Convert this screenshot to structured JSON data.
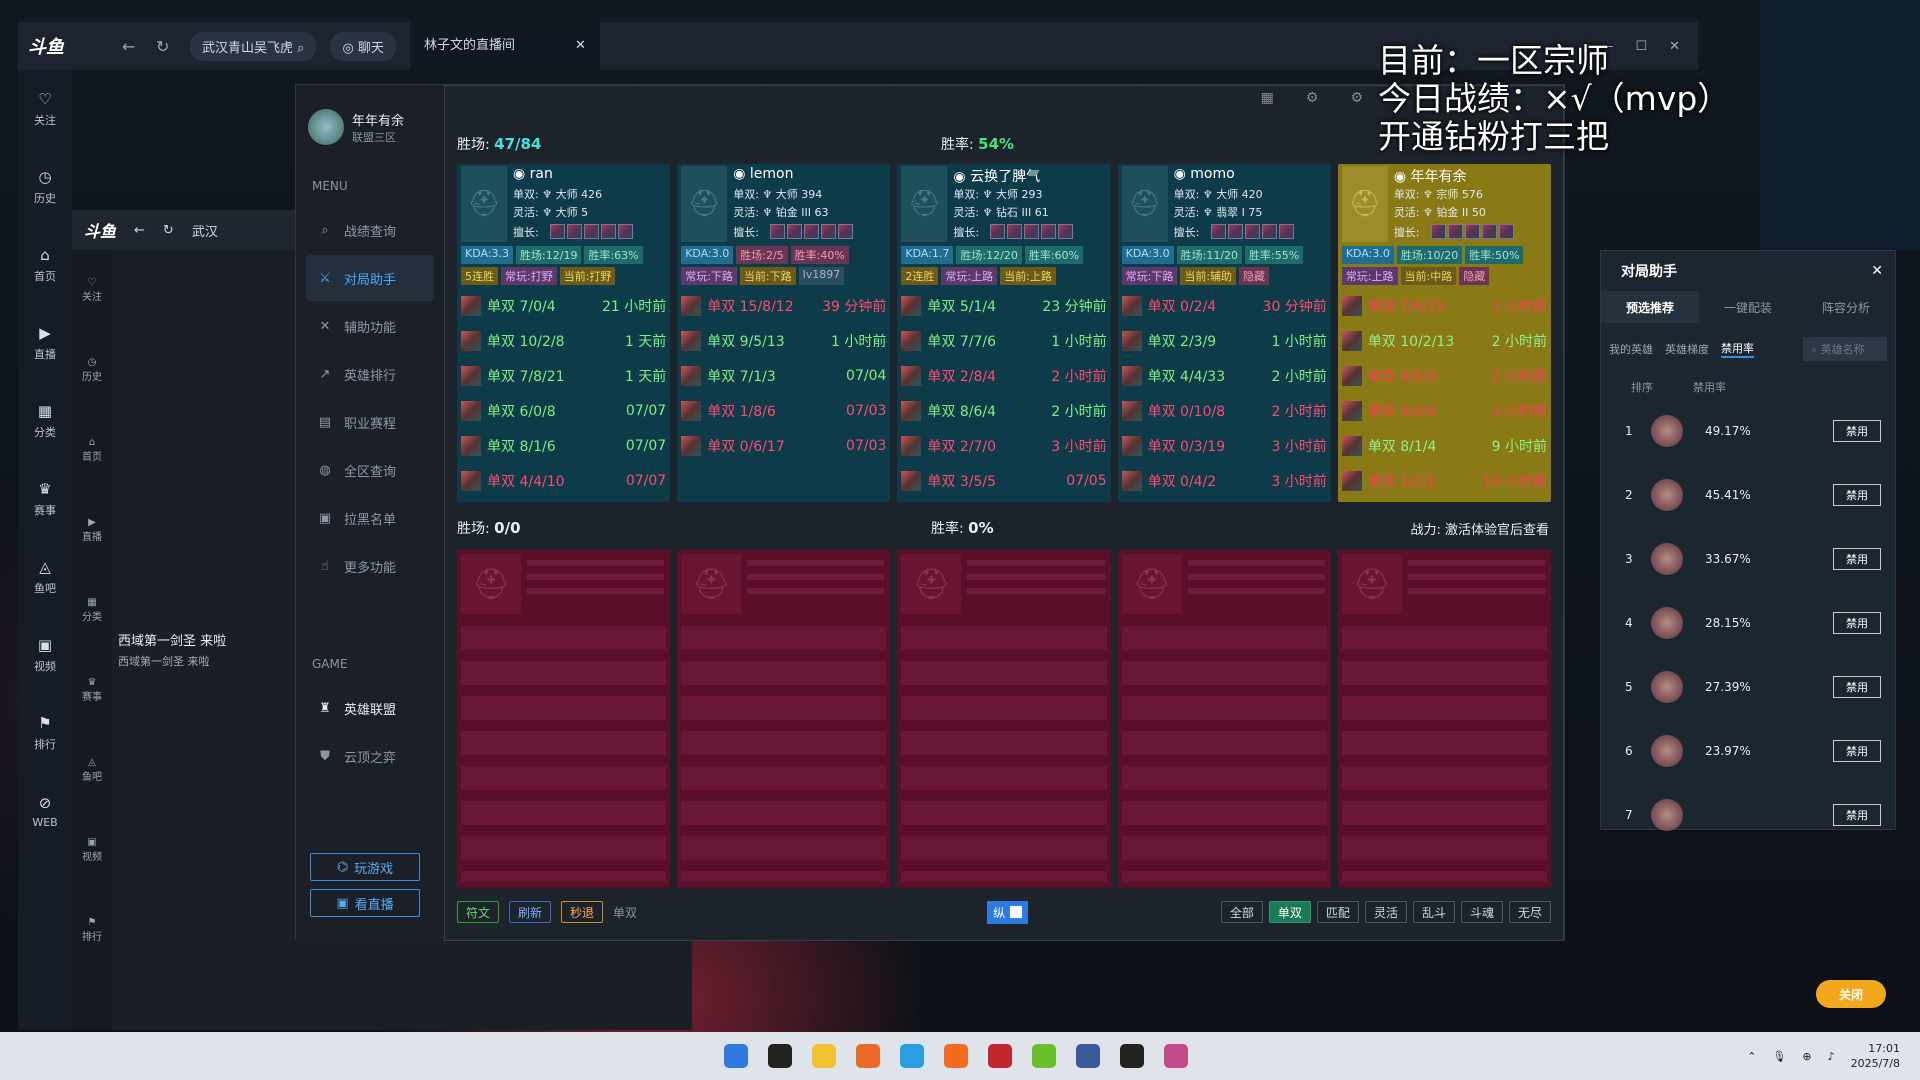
{
  "douyu": {
    "logo": "斗鱼",
    "location": "武汉青山吴飞虎",
    "chat": "聊天",
    "tab_title": "林子文的直播间"
  },
  "rail": [
    "关注",
    "历史",
    "首页",
    "直播",
    "分类",
    "赛事",
    "鱼吧",
    "视频",
    "排行",
    "WEB"
  ],
  "inner": {
    "location": "武汉",
    "rail": [
      "关注",
      "历史",
      "首页",
      "直播",
      "分类",
      "赛事",
      "鱼吧",
      "视频",
      "排行",
      "WEB"
    ],
    "msg1": "西域第一剑圣 来啦",
    "msg2": "西域第一剑圣 来啦"
  },
  "caption": {
    "line1": "目前：一区宗师",
    "line2": "今日战绩：×√（mvp）",
    "line3": "开通钻粉打三把"
  },
  "sidebar": {
    "name": "年年有余",
    "server": "联盟三区",
    "menu": "MENU",
    "items": [
      "战绩查询",
      "对局助手",
      "辅助功能",
      "英雄排行",
      "职业赛程",
      "全区查询",
      "拉黑名单",
      "更多功能"
    ],
    "game": "GAME",
    "games": [
      "英雄联盟",
      "云顶之弈"
    ],
    "play": "玩游戏",
    "watch": "看直播"
  },
  "ally": {
    "wins_label": "胜场:",
    "wins": "47/84",
    "rate_label": "胜率:",
    "rate": "54%"
  },
  "enemy": {
    "wins_label": "胜场:",
    "wins": "0/0",
    "rate_label": "胜率:",
    "rate": "0%",
    "power": "战力: 激活体验官后查看"
  },
  "players": [
    {
      "name": "ran",
      "solo": "单双: ",
      "solo_rank": "大师 426",
      "flex": "灵活: ",
      "flex_rank": "大师 5",
      "good": "擅长:",
      "tags": [
        [
          "KDA:3.3",
          "k"
        ],
        [
          "胜场:12/19",
          "t"
        ],
        [
          "胜率:63%",
          "t"
        ],
        [
          "5连胜",
          "y"
        ],
        [
          "常玩:打野",
          "p"
        ],
        [
          "当前:打野",
          "y"
        ]
      ],
      "matches": [
        [
          "单双 7/0/4",
          "21 小时前",
          "w"
        ],
        [
          "单双 10/2/8",
          "1 天前",
          "w"
        ],
        [
          "单双 7/8/21",
          "1 天前",
          "w"
        ],
        [
          "单双 6/0/8",
          "07/07",
          "w"
        ],
        [
          "单双 8/1/6",
          "07/07",
          "w"
        ],
        [
          "单双 4/4/10",
          "07/07",
          "l"
        ]
      ]
    },
    {
      "name": "lemon",
      "solo": "单双: ",
      "solo_rank": "大师 394",
      "flex": "灵活: ",
      "flex_rank": "铂金 III 63",
      "good": "擅长:",
      "tags": [
        [
          "KDA:3.0",
          "k"
        ],
        [
          "胜场:2/5",
          "r"
        ],
        [
          "胜率:40%",
          "r"
        ],
        [
          "常玩:下路",
          "p"
        ],
        [
          "当前:下路",
          "y"
        ],
        [
          "lv1897",
          "g"
        ]
      ],
      "matches": [
        [
          "单双 15/8/12",
          "39 分钟前",
          "l"
        ],
        [
          "单双 9/5/13",
          "1 小时前",
          "w"
        ],
        [
          "单双 7/1/3",
          "07/04",
          "w"
        ],
        [
          "单双 1/8/6",
          "07/03",
          "l"
        ],
        [
          "单双 0/6/17",
          "07/03",
          "l"
        ]
      ]
    },
    {
      "name": "云换了脾气",
      "solo": "单双: ",
      "solo_rank": "大师 293",
      "flex": "灵活: ",
      "flex_rank": "钻石 III 61",
      "good": "擅长:",
      "tags": [
        [
          "KDA:1.7",
          "k"
        ],
        [
          "胜场:12/20",
          "t"
        ],
        [
          "胜率:60%",
          "t"
        ],
        [
          "2连胜",
          "y"
        ],
        [
          "常玩:上路",
          "p"
        ],
        [
          "当前:上路",
          "y"
        ]
      ],
      "matches": [
        [
          "单双 5/1/4",
          "23 分钟前",
          "w"
        ],
        [
          "单双 7/7/6",
          "1 小时前",
          "w"
        ],
        [
          "单双 2/8/4",
          "2 小时前",
          "l"
        ],
        [
          "单双 8/6/4",
          "2 小时前",
          "w"
        ],
        [
          "单双 2/7/0",
          "3 小时前",
          "l"
        ],
        [
          "单双 3/5/5",
          "07/05",
          "l"
        ]
      ]
    },
    {
      "name": "momo",
      "solo": "单双: ",
      "solo_rank": "大师 420",
      "flex": "灵活: ",
      "flex_rank": "翡翠 I 75",
      "good": "擅长:",
      "tags": [
        [
          "KDA:3.0",
          "k"
        ],
        [
          "胜场:11/20",
          "t"
        ],
        [
          "胜率:55%",
          "t"
        ],
        [
          "常玩:下路",
          "p"
        ],
        [
          "当前:辅助",
          "y"
        ],
        [
          "隐藏",
          "r"
        ]
      ],
      "matches": [
        [
          "单双 0/2/4",
          "30 分钟前",
          "l"
        ],
        [
          "单双 2/3/9",
          "1 小时前",
          "w"
        ],
        [
          "单双 4/4/33",
          "2 小时前",
          "w"
        ],
        [
          "单双 0/10/8",
          "2 小时前",
          "l"
        ],
        [
          "单双 0/3/19",
          "3 小时前",
          "l"
        ],
        [
          "单双 0/4/2",
          "3 小时前",
          "l"
        ]
      ]
    },
    {
      "name": "年年有余",
      "solo": "单双: ",
      "solo_rank": "宗师 576",
      "flex": "灵活: ",
      "flex_rank": "铂金 II 50",
      "good": "擅长:",
      "tags": [
        [
          "KDA:3.0",
          "k"
        ],
        [
          "胜场:10/20",
          "t"
        ],
        [
          "胜率:50%",
          "t"
        ],
        [
          "常玩:上路",
          "p"
        ],
        [
          "当前:中路",
          "y"
        ],
        [
          "隐藏",
          "r"
        ]
      ],
      "matches": [
        [
          "单双 7/4/15",
          "1 小时前",
          "l"
        ],
        [
          "单双 10/2/13",
          "2 小时前",
          "w"
        ],
        [
          "单双 4/5/3",
          "2 小时前",
          "l"
        ],
        [
          "单双 4/4/4",
          "3 小时前",
          "l"
        ],
        [
          "单双 8/1/4",
          "9 小时前",
          "w"
        ],
        [
          "单双 1/2/2",
          "10 小时前",
          "l"
        ]
      ]
    }
  ],
  "bottom": {
    "rune": "符文",
    "refresh": "刷新",
    "quit": "秒退",
    "mode": "单双",
    "toggle": "纵",
    "filters": [
      "全部",
      "单双",
      "匹配",
      "灵活",
      "乱斗",
      "斗魂",
      "无尽"
    ]
  },
  "rp": {
    "title": "对局助手",
    "tabs": [
      "预选推荐",
      "一键配装",
      "阵容分析"
    ],
    "sub": [
      "我的英雄",
      "英雄梯度",
      "禁用率"
    ],
    "search": "英雄名称",
    "h1": "排序",
    "h2": "禁用率",
    "rows": [
      [
        "1",
        "49.17%"
      ],
      [
        "2",
        "45.41%"
      ],
      [
        "3",
        "33.67%"
      ],
      [
        "4",
        "28.15%"
      ],
      [
        "5",
        "27.39%"
      ],
      [
        "6",
        "23.97%"
      ],
      [
        "7",
        ""
      ]
    ],
    "ban": "禁用",
    "close": "关闭"
  },
  "clock": {
    "time": "17:01",
    "date": "2025/7/8"
  },
  "icons": {
    "search": "search-icon",
    "gear": "gear-icon",
    "close": "close-icon"
  }
}
